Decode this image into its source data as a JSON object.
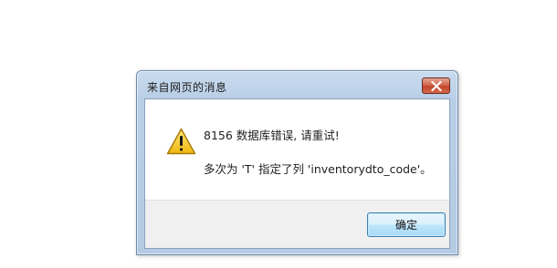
{
  "dialog": {
    "title": "来自网页的消息",
    "close_icon": "close-x-icon",
    "message_icon": "warning-icon",
    "message_line1": "8156 数据库错误, 请重试!",
    "message_line2": "多次为 'T' 指定了列 'inventorydto_code'。",
    "ok_label": "确定"
  },
  "colors": {
    "close_button": "#c2452a",
    "warning_fill": "#f5c518",
    "ok_button_border": "#3c7fb1"
  }
}
